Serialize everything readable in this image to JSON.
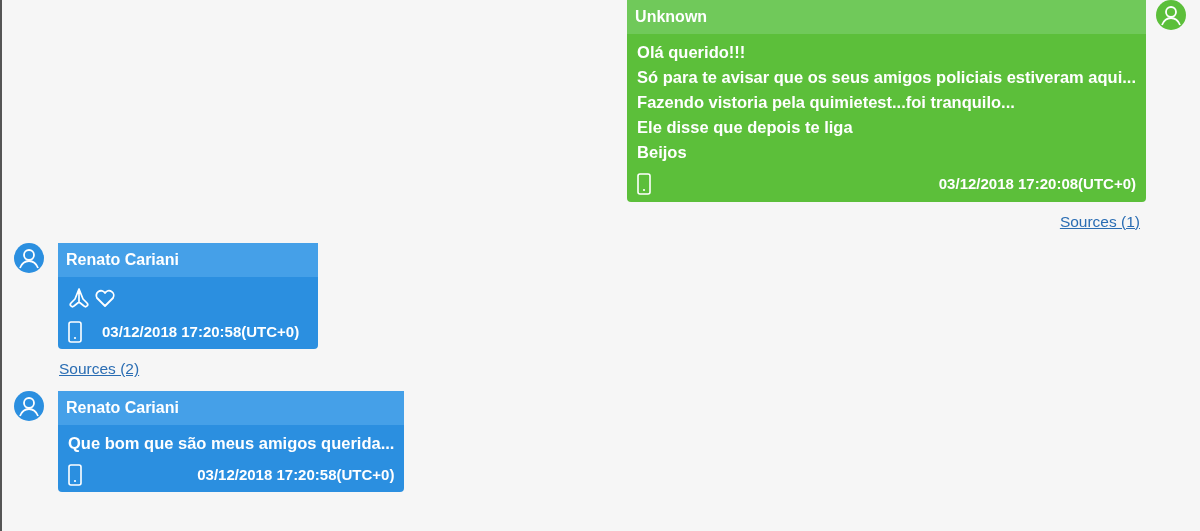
{
  "messages": [
    {
      "kind": "outgoing",
      "sender": "Unknown",
      "lines": [
        "Olá querido!!!",
        "Só para te avisar que os seus amigos policiais estiveram aqui...",
        "Fazendo vistoria pela quimietest...foi tranquilo...",
        "Ele disse que depois te liga",
        "Beijos"
      ],
      "timestamp": "03/12/2018 17:20:08(UTC+0)",
      "sources": "Sources (1)"
    },
    {
      "kind": "incoming",
      "sender": "Renato Cariani",
      "emoji": [
        {
          "kind": "praying-hands"
        },
        {
          "kind": "heart"
        }
      ],
      "timestamp": "03/12/2018 17:20:58(UTC+0)",
      "sources": "Sources (2)"
    },
    {
      "kind": "incoming",
      "sender": "Renato Cariani",
      "lines": [
        "Que bom que são meus amigos querida..."
      ],
      "timestamp": "03/12/2018 17:20:58(UTC+0)"
    }
  ]
}
